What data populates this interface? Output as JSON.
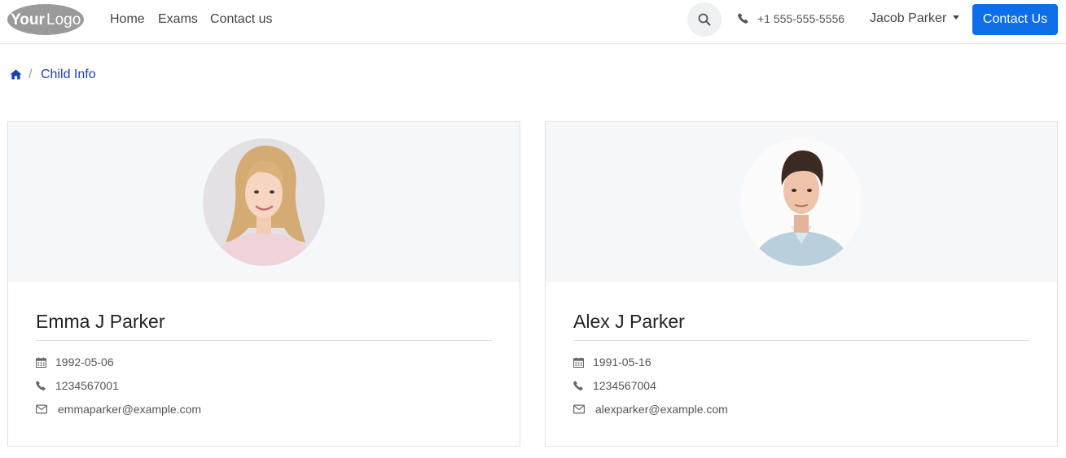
{
  "brand": {
    "logo_text_bold": "Your",
    "logo_text_light": "Logo"
  },
  "nav": {
    "links": [
      {
        "label": "Home"
      },
      {
        "label": "Exams"
      },
      {
        "label": "Contact us"
      }
    ],
    "phone": "+1 555-555-5556",
    "user_name": "Jacob Parker",
    "contact_button": "Contact Us"
  },
  "breadcrumb": {
    "separator": "/",
    "current": "Child Info"
  },
  "children": [
    {
      "name": "Emma J Parker",
      "dob": "1992-05-06",
      "phone": "1234567001",
      "email": "emmaparker@example.com"
    },
    {
      "name": "Alex J Parker",
      "dob": "1991-05-16",
      "phone": "1234567004",
      "email": "alexparker@example.com"
    }
  ],
  "colors": {
    "primary": "#0d6ee8",
    "link": "#1a3fb5",
    "card_header_bg": "#f6f7f9"
  }
}
